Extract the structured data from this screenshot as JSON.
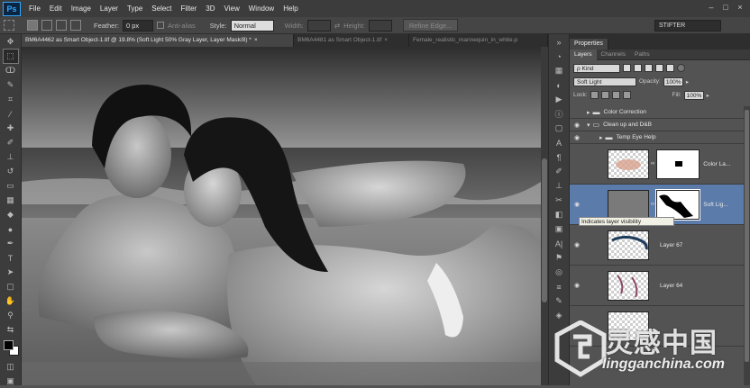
{
  "app": {
    "logo": "Ps"
  },
  "menu": [
    "File",
    "Edit",
    "Image",
    "Layer",
    "Type",
    "Select",
    "Filter",
    "3D",
    "View",
    "Window",
    "Help"
  ],
  "window_controls": [
    "–",
    "□",
    "×"
  ],
  "options": {
    "feather_label": "Feather:",
    "feather_value": "0 px",
    "antialias_label": "Anti-alias",
    "style_label": "Style:",
    "style_value": "Normal",
    "width_label": "Width:",
    "height_label": "Height:",
    "refine_edge": "Refine Edge...",
    "workspace": "STIFTER"
  },
  "tabs": [
    {
      "label": "BM6A4462 as Smart Object-1.tif @ 19.8% (Soft Light 50% Gray Layer, Layer Mask/8) *",
      "close": "×",
      "active": true
    },
    {
      "label": "BM6A4481 as Smart Object-1.tif",
      "close": "×",
      "active": false
    },
    {
      "label": "Female_realistic_mannequin_in_white.p",
      "close": "",
      "active": false
    }
  ],
  "panel": {
    "properties_tab": "Properties",
    "layer_tabs": [
      "Layers",
      "Channels",
      "Paths"
    ],
    "filter_kind": "ρ Kind",
    "blend_mode": "Soft Light",
    "opacity_label": "Opacity:",
    "opacity_value": "100%",
    "lock_label": "Lock:",
    "fill_label": "Fill:",
    "fill_value": "100%"
  },
  "layers": [
    {
      "name": "Color Correction",
      "type": "group",
      "expanded": false,
      "eye": false
    },
    {
      "name": "Clean up and D&B",
      "type": "group",
      "expanded": true,
      "eye": true
    },
    {
      "name": "Temp Eye Help",
      "type": "group",
      "expanded": false,
      "eye": true
    },
    {
      "name": "Color La...",
      "type": "layer",
      "eye": false
    },
    {
      "name": "Soft Lig...",
      "type": "layer",
      "eye": true,
      "selected": true
    },
    {
      "name": "Layer 67",
      "type": "layer",
      "eye": true
    },
    {
      "name": "Layer 64",
      "type": "layer",
      "eye": true
    }
  ],
  "tooltip": "Indicates layer visibility",
  "watermark": {
    "cn": "灵感中国",
    "url": "lingganchina.com"
  },
  "colors": {
    "selected_layer": "#5b7bab",
    "ps_blue": "#31a8ff"
  }
}
